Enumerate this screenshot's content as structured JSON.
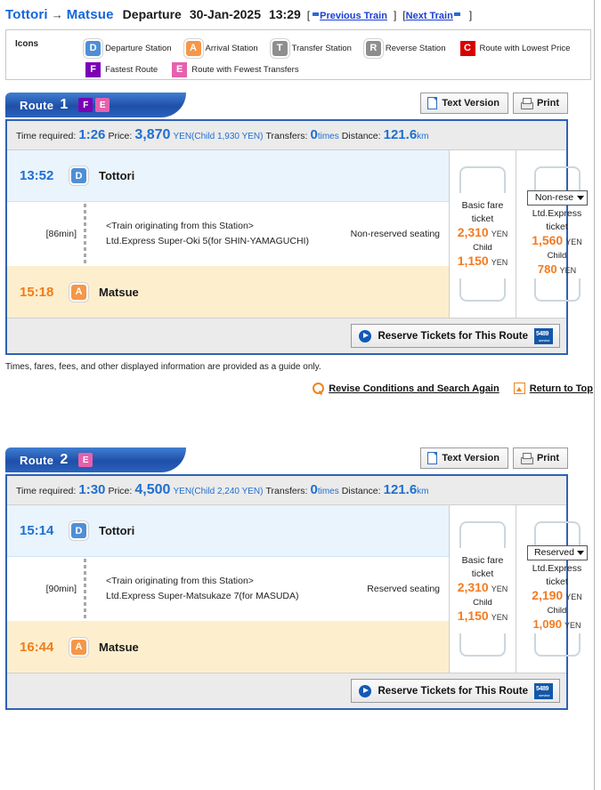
{
  "header": {
    "origin": "Tottori",
    "arrow": "→",
    "destination": "Matsue",
    "departure_label": "Departure",
    "date": "30-Jan-2025",
    "time": "13:29",
    "bracket_open": "[",
    "bracket_close": "]",
    "bracket_open2": "[",
    "bracket_close2": "]",
    "previous_train": "Previous Train",
    "next_train": "Next Train"
  },
  "legend": {
    "title": "Icons",
    "items": [
      {
        "code": "D",
        "label": "Departure Station",
        "color": "#4f8fd6",
        "style": "rounded"
      },
      {
        "code": "A",
        "label": "Arrival Station",
        "color": "#f79646",
        "style": "rounded"
      },
      {
        "code": "T",
        "label": "Transfer Station",
        "color": "#8e8e8e",
        "style": "rounded"
      },
      {
        "code": "R",
        "label": "Reverse Station",
        "color": "#8e8e8e",
        "style": "rounded"
      },
      {
        "code": "C",
        "label": "Route with Lowest Price",
        "color": "#d80000",
        "style": "flat"
      },
      {
        "code": "F",
        "label": "Fastest Route",
        "color": "#7b00b5",
        "style": "flat"
      },
      {
        "code": "E",
        "label": "Route with Fewest Transfers",
        "color": "#e660ad",
        "style": "flat"
      }
    ]
  },
  "toolbar": {
    "text_version": "Text Version",
    "print": "Print"
  },
  "common": {
    "time_required_label": "Time required:",
    "price_label": "Price:",
    "transfers_label": "Transfers:",
    "distance_label": "Distance:",
    "times_unit": "times",
    "km_unit": "km",
    "route_word": "Route",
    "basic_fare_ticket": "Basic fare\nticket",
    "basic_fare_line1": "Basic fare",
    "basic_fare_line2": "ticket",
    "ltd_express_line1": "Ltd.Express",
    "ltd_express_line2": "ticket",
    "child_label": "Child",
    "yen": "YEN",
    "reserve_button": "Reserve Tickets for This Route",
    "minilogo_text": "5489",
    "minilogo_sub": "service"
  },
  "routes": [
    {
      "number": "1",
      "badges": [
        {
          "code": "F",
          "color": "#7b00b5"
        },
        {
          "code": "E",
          "color": "#e660ad"
        }
      ],
      "time_required": "1:26",
      "price": "3,870",
      "price_child_note": "YEN(Child 1,930 YEN)",
      "transfers": "0",
      "distance": "121.6",
      "departure": {
        "time": "13:52",
        "icon": "D",
        "station": "Tottori"
      },
      "arrival": {
        "time": "15:18",
        "icon": "A",
        "station": "Matsue"
      },
      "segment": {
        "duration": "[86min]",
        "line1": "<Train originating from this Station>",
        "line2": "Ltd.Express Super-Oki 5(for SHIN-YAMAGUCHI)",
        "seating": "Non-reserved seating"
      },
      "basic_fare": {
        "adult": "2,310",
        "child": "1,150"
      },
      "express_fare": {
        "select_value": "Non-rese",
        "adult": "1,560",
        "child": "780"
      }
    },
    {
      "number": "2",
      "badges": [
        {
          "code": "E",
          "color": "#e660ad"
        }
      ],
      "time_required": "1:30",
      "price": "4,500",
      "price_child_note": "YEN(Child 2,240 YEN)",
      "transfers": "0",
      "distance": "121.6",
      "departure": {
        "time": "15:14",
        "icon": "D",
        "station": "Tottori"
      },
      "arrival": {
        "time": "16:44",
        "icon": "A",
        "station": "Matsue"
      },
      "segment": {
        "duration": "[90min]",
        "line1": "<Train originating from this Station>",
        "line2": "Ltd.Express Super-Matsukaze 7(for MASUDA)",
        "seating": "Reserved seating"
      },
      "basic_fare": {
        "adult": "2,310",
        "child": "1,150"
      },
      "express_fare": {
        "select_value": "Reserved",
        "adult": "2,190",
        "child": "1,090"
      }
    }
  ],
  "footer": {
    "disclaimer": "Times, fares, fees, and other displayed information are provided as a guide only.",
    "revise": "Revise Conditions and Search Again",
    "return_top": "Return to Top"
  }
}
